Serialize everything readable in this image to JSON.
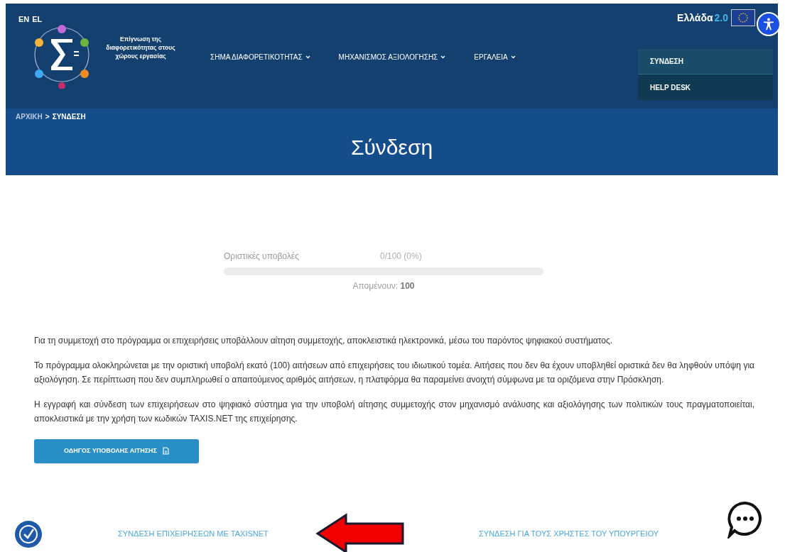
{
  "header": {
    "languages": [
      {
        "label": "EN"
      },
      {
        "label": "EL"
      }
    ],
    "logo_text": "Επίγνωση της διαφορετικότητας στους χώρους εργασίας",
    "nav": [
      {
        "label": "ΣΗΜΑ ΔΙΑΦΟΡΕΤΙΚΟΤΗΤΑΣ"
      },
      {
        "label": "ΜΗΧΑΝΙΣΜΟΣ ΑΞΙΟΛΟΓΗΣΗΣ"
      },
      {
        "label": "ΕΡΓΑΛΕΙΑ"
      }
    ],
    "partner_logo": {
      "name": "Ελλάδα",
      "version": "2.0"
    },
    "user_menu": [
      {
        "label": "ΣΥΝΔΕΣΗ"
      },
      {
        "label": "HELP DESK"
      }
    ]
  },
  "breadcrumb": [
    {
      "label": "ΑΡΧΙΚΗ"
    },
    {
      "label": "ΣΥΝΔΕΣΗ"
    }
  ],
  "breadcrumb_separator": ">",
  "page_title": "Σύνδεση",
  "progress": {
    "label": "Οριστικές υποβολές",
    "reading": "0/100 (0%)",
    "level": 0,
    "remaining_label": "Απομένουν:",
    "remaining": "100"
  },
  "paragraphs": [
    "Για τη συμμετοχή στο πρόγραμμα οι επιχειρήσεις υποβάλλουν αίτηση συμμετοχής, αποκλειστικά ηλεκτρονικά, μέσω του παρόντος ψηφιακού συστήματος.",
    "Το πρόγραμμα ολοκληρώνεται με την οριστική υποβολή εκατό (100) αιτήσεων από επιχειρήσεις του ιδιωτικού τομέα. Αιτήσεις που δεν θα έχουν υποβληθεί οριστικά δεν θα ληφθούν υπόψη για αξιολόγηση. Σε περίπτωση που δεν συμπληρωθεί ο απαιτούμενος αριθμός αιτήσεων, η πλατφόρμα θα παραμείνει ανοιχτή σύμφωνα με τα οριζόμενα στην Πρόσκληση.",
    "Η εγγραφή και σύνδεση των επιχειρήσεων στο ψηφιακό σύστημα για την υποβολή αίτησης συμμετοχής στον μηχανισμό ανάλυσης και αξιολόγησης των πολιτικών τους πραγματοποιείται, αποκλειστικά με την χρήση των κωδικών TAXIS.NET της επιχείρησης."
  ],
  "guide_button": "ΟΔΗΓΟΣ ΥΠΟΒΟΛΗΣ ΑΙΤΗΣΗΣ",
  "login_links": [
    "ΣΥΝΔΕΣΗ ΕΠΙΧΕΙΡΗΣΕΩΝ ΜΕ TAXISNET",
    "ΣΥΝΔΕΣΗ ΓΙΑ ΤΟΥΣ ΧΡΗΣΤΕΣ ΤΟΥ ΥΠΟΥΡΓΕΙΟΥ"
  ]
}
